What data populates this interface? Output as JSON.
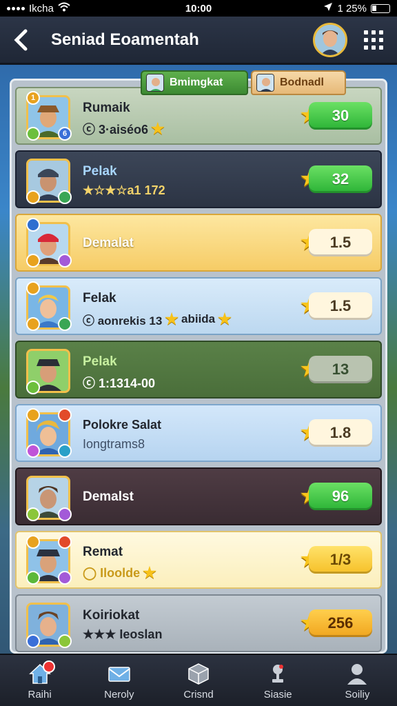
{
  "status_bar": {
    "carrier": "Ikcha",
    "time": "10:00",
    "battery": "1 25%"
  },
  "header": {
    "title": "Seniad Eoamentah"
  },
  "tabs": [
    {
      "label": "Bmimgkat"
    },
    {
      "label": "Bodnadl"
    }
  ],
  "leaderboard": [
    {
      "name": "Rumaik",
      "subtitle": "ⓒ 3·aiséo6",
      "score": "30",
      "style": "green"
    },
    {
      "name": "Pelak",
      "subtitle": "★☆★☆a1 172",
      "score": "32",
      "style": "dark"
    },
    {
      "name": "Demalat",
      "subtitle": "",
      "score": "1.5",
      "style": "gold"
    },
    {
      "name": "Felak",
      "subtitle": "ⓒ aonrekis 13",
      "subtitle_extra": "abiida",
      "score": "1.5",
      "style": "blue"
    },
    {
      "name": "Pelak",
      "subtitle": "ⓒ 1:1314-00",
      "score": "13",
      "style": "olive"
    },
    {
      "name": "Polokre Salat",
      "subtitle": "Iongtrams8",
      "score": "1.8",
      "style": "blue2"
    },
    {
      "name": "Demalst",
      "subtitle": "",
      "score": "96",
      "style": "maroon"
    },
    {
      "name": "Remat",
      "subtitle": "◯ Iloolde",
      "score": "1/3",
      "style": "cream"
    },
    {
      "name": "Koiriokat",
      "subtitle": "★★★ Ieoslan",
      "score": "256",
      "style": "grey"
    }
  ],
  "bottom_nav": [
    {
      "label": "Raihi",
      "icon": "home-icon"
    },
    {
      "label": "Neroly",
      "icon": "mail-icon"
    },
    {
      "label": "Crisnd",
      "icon": "box-icon"
    },
    {
      "label": "Siasie",
      "icon": "trophy-icon"
    },
    {
      "label": "Soiliy",
      "icon": "profile-icon"
    }
  ],
  "colors": {
    "accent_green": "#2bb336",
    "gold": "#f6cc66",
    "star": "#f9c51c"
  }
}
